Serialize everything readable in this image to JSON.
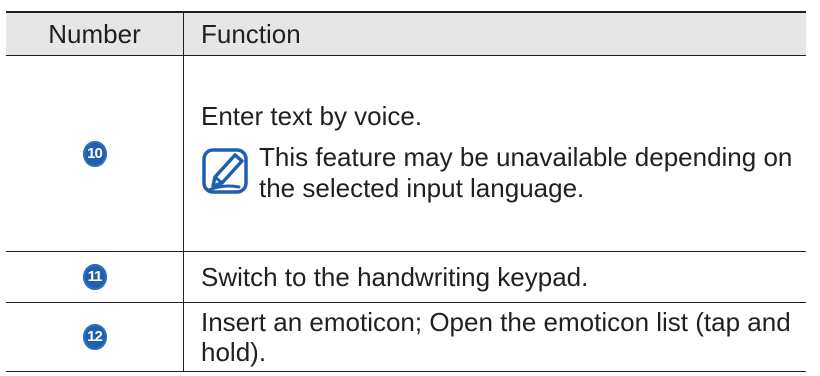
{
  "table": {
    "headers": {
      "number": "Number",
      "function": "Function"
    },
    "rows": [
      {
        "number": "10",
        "text": "Enter text by voice.",
        "note": "This feature may be unavailable depending on the selected input language.",
        "note_icon": "note-pencil-icon"
      },
      {
        "number": "11",
        "text": "Switch to the handwriting keypad."
      },
      {
        "number": "12",
        "text": "Insert an emoticon; Open the emoticon list (tap and hold)."
      }
    ]
  },
  "colors": {
    "badge": "#1f5fae",
    "header_bg": "#e6e6e6",
    "text": "#231f20"
  }
}
